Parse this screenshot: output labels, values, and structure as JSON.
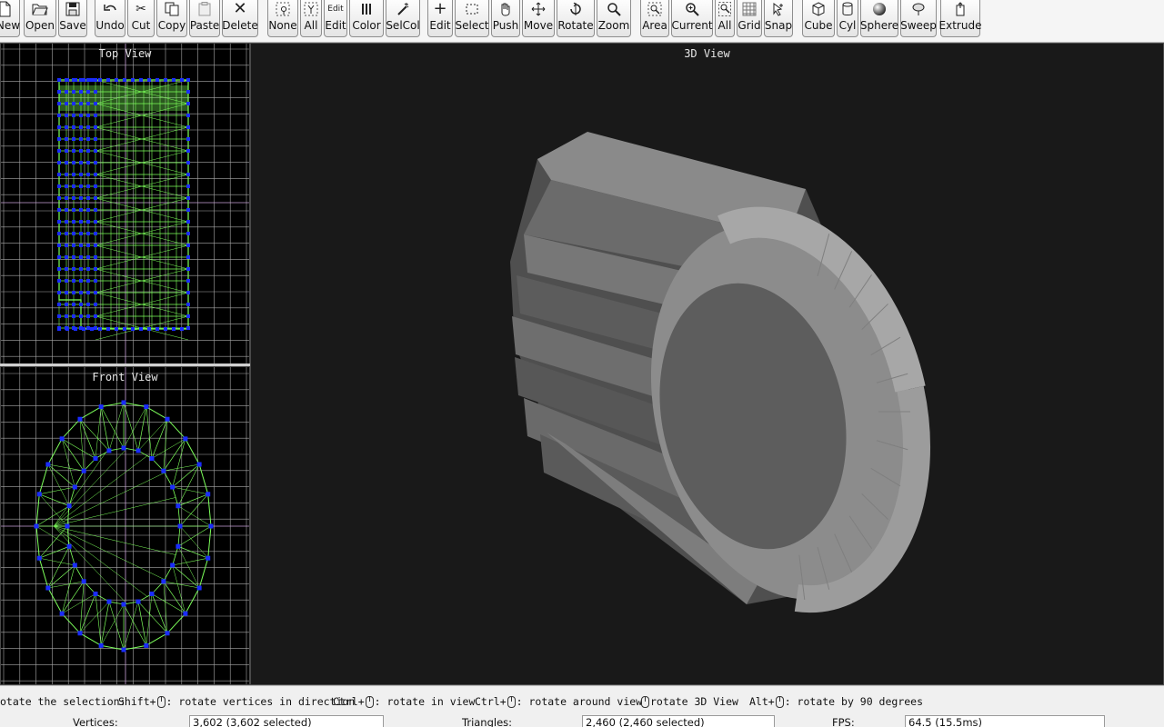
{
  "toolbar": {
    "buttons": [
      {
        "label": "New",
        "icon": "new-file-icon"
      },
      {
        "label": "Open",
        "icon": "open-folder-icon"
      },
      {
        "label": "Save",
        "icon": "save-disk-icon"
      },
      {
        "label": "Undo",
        "icon": "undo-arrow-icon"
      },
      {
        "label": "Cut",
        "icon": "scissors-icon"
      },
      {
        "label": "Copy",
        "icon": "copy-icon"
      },
      {
        "label": "Paste",
        "icon": "paste-icon"
      },
      {
        "label": "Delete",
        "icon": "x-delete-icon"
      },
      {
        "label": "None",
        "icon": "select-none-icon"
      },
      {
        "label": "All",
        "icon": "select-all-icon"
      },
      {
        "label": "Edit",
        "icon": "edit-mode-icon",
        "icon_text": "Edit"
      },
      {
        "label": "Color",
        "icon": "color-bars-icon"
      },
      {
        "label": "SelCol",
        "icon": "wand-icon"
      },
      {
        "label": "Edit",
        "icon": "crosshair-icon"
      },
      {
        "label": "Select",
        "icon": "dashed-rect-icon"
      },
      {
        "label": "Push",
        "icon": "hand-icon"
      },
      {
        "label": "Move",
        "icon": "move-arrows-icon"
      },
      {
        "label": "Rotate",
        "icon": "rotate-icon"
      },
      {
        "label": "Zoom",
        "icon": "magnifier-icon"
      },
      {
        "label": "Area",
        "icon": "zoom-area-icon"
      },
      {
        "label": "Current",
        "icon": "zoom-current-icon"
      },
      {
        "label": "All",
        "icon": "zoom-all-icon"
      },
      {
        "label": "Grid",
        "icon": "grid-icon"
      },
      {
        "label": "Snap",
        "icon": "snap-cursor-icon"
      },
      {
        "label": "Cube",
        "icon": "cube-icon"
      },
      {
        "label": "Cyl",
        "icon": "cylinder-icon"
      },
      {
        "label": "Sphere",
        "icon": "sphere-icon"
      },
      {
        "label": "Sweep",
        "icon": "sweep-icon"
      },
      {
        "label": "Extrude",
        "icon": "extrude-icon"
      }
    ]
  },
  "viewports": {
    "top": {
      "title": "Top View"
    },
    "front": {
      "title": "Front View"
    },
    "view3d": {
      "title": "3D View"
    }
  },
  "hints": [
    {
      "text": "otate the selection:"
    },
    {
      "prefix": "Shift+",
      "suffix": ": rotate vertices in direction"
    },
    {
      "prefix": "Ctrl+",
      "suffix": ": rotate in view"
    },
    {
      "prefix": "Ctrl+",
      "suffix": ": rotate around view"
    },
    {
      "prefix": "",
      "suffix": "rotate 3D View"
    },
    {
      "prefix": "Alt+",
      "suffix": ": rotate by 90 degrees"
    }
  ],
  "status": {
    "vertices_label": "Vertices:",
    "vertices_value": "3,602   (3,602 selected)",
    "triangles_label": "Triangles:",
    "triangles_value": "2,460   (2,460 selected)",
    "fps_label": "FPS:",
    "fps_value": "64.5 (15.5ms)"
  },
  "colors": {
    "viewport_bg": "#000000",
    "grid": "#a9a9a9",
    "wire": "#7cff5a",
    "vertex": "#1a2cff",
    "view3d_bg": "#191919",
    "mesh": "#7a7a7a"
  }
}
